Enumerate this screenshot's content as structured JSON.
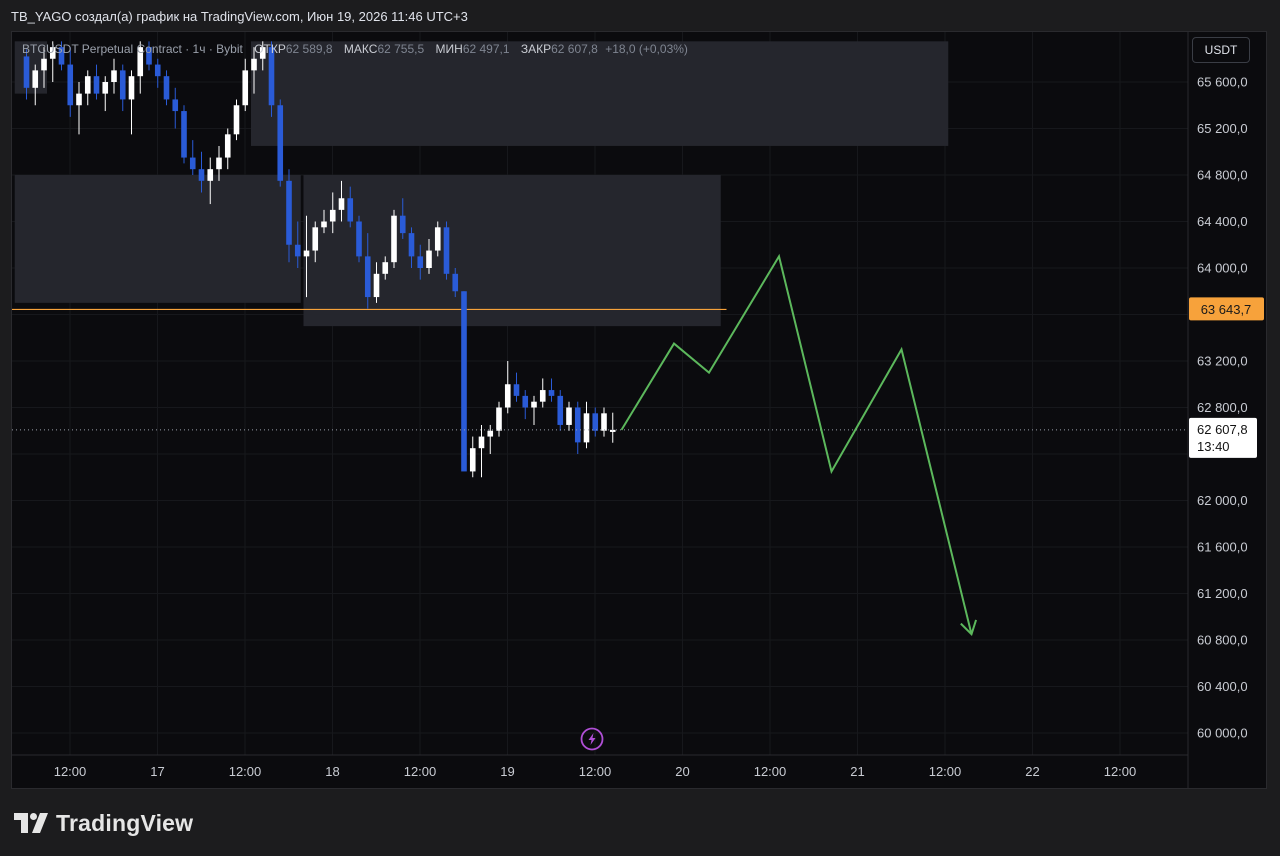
{
  "header": {
    "caption": "TB_YAGO создал(а) график на TradingView.com, Июн 19, 2026 11:46 UTC+3"
  },
  "legend": {
    "symbol": "BTCUSDT Perpetual Contract",
    "interval": "1ч",
    "exchange": "Bybit",
    "open_label": "ОТКР",
    "open_value": "62 589,8",
    "high_label": "МАКС",
    "high_value": "62 755,5",
    "low_label": "МИН",
    "low_value": "62 497,1",
    "close_label": "ЗАКР",
    "close_value": "62 607,8",
    "change": "+18,0 (+0,03%)"
  },
  "price_axis": {
    "currency": "USDT",
    "labels": [
      "65 600,0",
      "65 200,0",
      "64 800,0",
      "64 400,0",
      "64 000,0",
      "63 200,0",
      "62 800,0",
      "62 000,0",
      "61 600,0",
      "61 200,0",
      "60 800,0",
      "60 400,0",
      "60 000,0"
    ]
  },
  "price_tags": {
    "level_value": "63 643,7",
    "last_price": "62 607,8",
    "countdown": "13:40"
  },
  "time_axis": {
    "labels": [
      "12:00",
      "17",
      "12:00",
      "18",
      "12:00",
      "19",
      "12:00",
      "20",
      "12:00",
      "21",
      "12:00",
      "22",
      "12:00"
    ]
  },
  "colors": {
    "background": "#0b0b0e",
    "up_candle": "#ffffff",
    "down_candle": "#2a5bd7",
    "projection": "#5cb85c",
    "level_line": "#f7a23b",
    "zone": "#25262d",
    "alert_icon": "#b04fd6"
  },
  "icons": {
    "alert": "lightning-icon"
  },
  "branding": {
    "logo_text": "TradingView"
  },
  "chart_data": {
    "type": "candlestick",
    "title": "BTCUSDT Perpetual Contract · 1ч · Bybit",
    "ylim": [
      59900,
      65950
    ],
    "time_labels": [
      "16 12:00",
      "17",
      "17 12:00",
      "18",
      "18 12:00",
      "19",
      "19 12:00",
      "20",
      "20 12:00",
      "21",
      "21 12:00",
      "22",
      "22 12:00"
    ],
    "candles": [
      [
        65820,
        65880,
        65450,
        65550
      ],
      [
        65550,
        65750,
        65400,
        65700
      ],
      [
        65700,
        65900,
        65550,
        65800
      ],
      [
        65800,
        65950,
        65600,
        65900
      ],
      [
        65900,
        65950,
        65700,
        65750
      ],
      [
        65750,
        65900,
        65300,
        65400
      ],
      [
        65400,
        65600,
        65150,
        65500
      ],
      [
        65500,
        65700,
        65400,
        65650
      ],
      [
        65650,
        65750,
        65450,
        65500
      ],
      [
        65500,
        65650,
        65350,
        65600
      ],
      [
        65600,
        65800,
        65500,
        65700
      ],
      [
        65700,
        65750,
        65350,
        65450
      ],
      [
        65450,
        65700,
        65150,
        65650
      ],
      [
        65650,
        65950,
        65500,
        65900
      ],
      [
        65900,
        65950,
        65700,
        65750
      ],
      [
        65750,
        65800,
        65550,
        65650
      ],
      [
        65650,
        65700,
        65400,
        65450
      ],
      [
        65450,
        65550,
        65200,
        65350
      ],
      [
        65350,
        65400,
        64900,
        64950
      ],
      [
        64950,
        65100,
        64800,
        64850
      ],
      [
        64850,
        65000,
        64650,
        64750
      ],
      [
        64750,
        64950,
        64550,
        64850
      ],
      [
        64850,
        65050,
        64750,
        64950
      ],
      [
        64950,
        65200,
        64850,
        65150
      ],
      [
        65150,
        65450,
        65100,
        65400
      ],
      [
        65400,
        65800,
        65350,
        65700
      ],
      [
        65700,
        65900,
        65500,
        65800
      ],
      [
        65800,
        65950,
        65700,
        65900
      ],
      [
        65900,
        65950,
        65300,
        65400
      ],
      [
        65400,
        65450,
        64700,
        64750
      ],
      [
        64750,
        64850,
        64050,
        64200
      ],
      [
        64200,
        64400,
        64000,
        64100
      ],
      [
        64100,
        64450,
        63750,
        64150
      ],
      [
        64150,
        64400,
        64050,
        64350
      ],
      [
        64350,
        64500,
        64300,
        64400
      ],
      [
        64400,
        64650,
        64300,
        64500
      ],
      [
        64500,
        64750,
        64400,
        64600
      ],
      [
        64600,
        64700,
        64350,
        64400
      ],
      [
        64400,
        64450,
        64050,
        64100
      ],
      [
        64100,
        64300,
        63650,
        63750
      ],
      [
        63750,
        64050,
        63700,
        63950
      ],
      [
        63950,
        64100,
        63900,
        64050
      ],
      [
        64050,
        64500,
        64000,
        64450
      ],
      [
        64450,
        64600,
        64250,
        64300
      ],
      [
        64300,
        64350,
        64000,
        64100
      ],
      [
        64100,
        64200,
        63900,
        64000
      ],
      [
        64000,
        64250,
        63950,
        64150
      ],
      [
        64150,
        64400,
        64100,
        64350
      ],
      [
        64350,
        64400,
        63900,
        63950
      ],
      [
        63950,
        64000,
        63750,
        63800
      ],
      [
        63800,
        63800,
        62350,
        62250
      ],
      [
        62250,
        62550,
        62200,
        62450
      ],
      [
        62450,
        62650,
        62200,
        62550
      ],
      [
        62550,
        62650,
        62400,
        62600
      ],
      [
        62600,
        62850,
        62550,
        62800
      ],
      [
        62800,
        63200,
        62750,
        63000
      ],
      [
        63000,
        63100,
        62850,
        62900
      ],
      [
        62900,
        62950,
        62700,
        62800
      ],
      [
        62800,
        62900,
        62650,
        62850
      ],
      [
        62850,
        63050,
        62800,
        62950
      ],
      [
        62950,
        63050,
        62850,
        62900
      ],
      [
        62900,
        62950,
        62600,
        62650
      ],
      [
        62650,
        62850,
        62600,
        62800
      ],
      [
        62800,
        62850,
        62400,
        62500
      ],
      [
        62500,
        62850,
        62450,
        62750
      ],
      [
        62750,
        62800,
        62550,
        62600
      ],
      [
        62600,
        62800,
        62550,
        62750
      ],
      [
        62589.8,
        62755.5,
        62497.1,
        62607.8
      ]
    ],
    "zones": [
      {
        "t_start": -1,
        "t_end": 2,
        "top": 65950,
        "bottom": 65500
      },
      {
        "t_start": 26,
        "t_end": 105,
        "top": 65950,
        "bottom": 65050
      },
      {
        "t_start": -1,
        "t_end": 31,
        "top": 64800,
        "bottom": 63700
      },
      {
        "t_start": 32,
        "t_end": 79,
        "top": 64800,
        "bottom": 63500
      }
    ],
    "level": {
      "price": 63643.7,
      "t_start": -1,
      "t_end": 80
    },
    "last_price": 62607.8,
    "projection": [
      [
        68,
        62607.8
      ],
      [
        74,
        63350
      ],
      [
        78,
        63100
      ],
      [
        86,
        64100
      ],
      [
        92,
        62250
      ],
      [
        100,
        63300
      ],
      [
        108,
        60850
      ]
    ]
  }
}
